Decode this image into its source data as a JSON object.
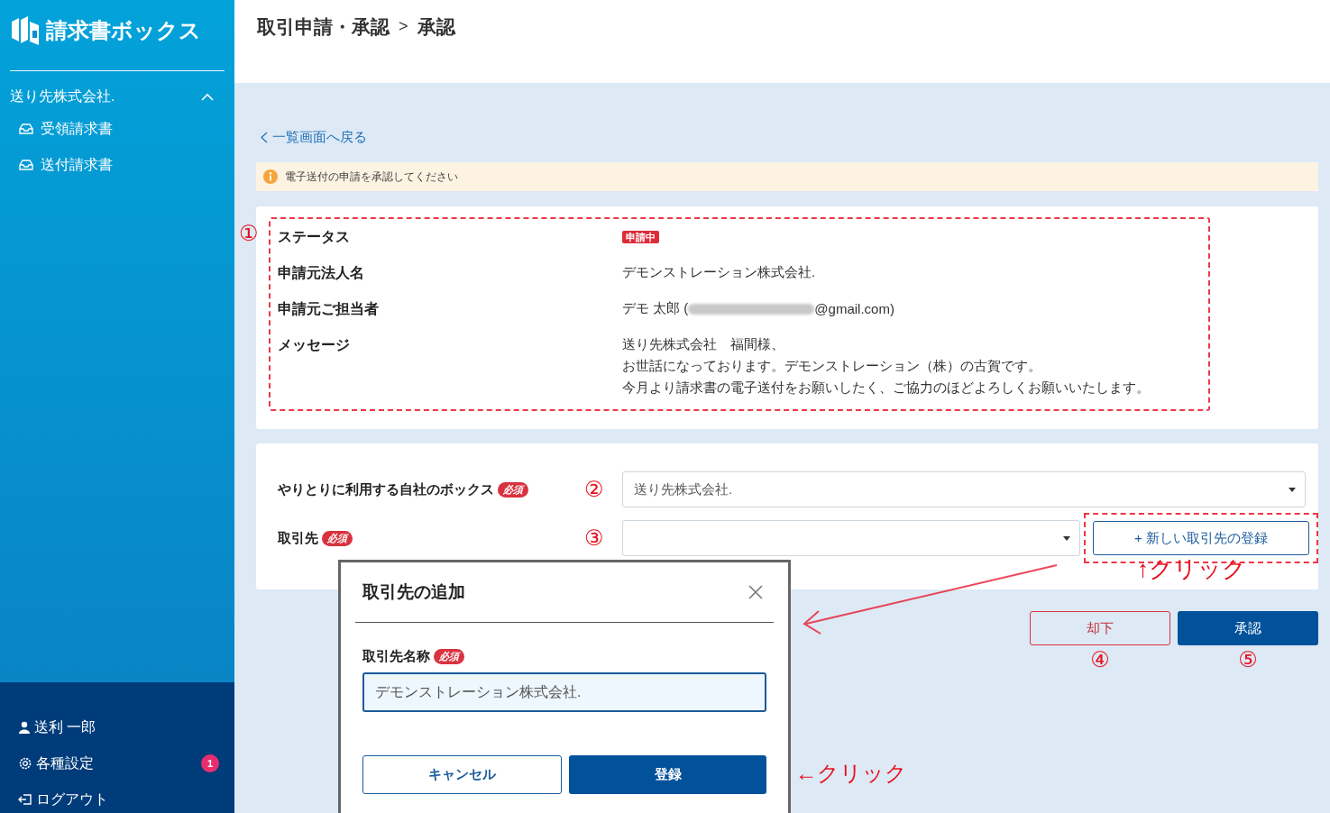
{
  "sidebar": {
    "logo": "請求書ボックス",
    "group": {
      "label": "送り先株式会社.",
      "expanded": true,
      "items": [
        {
          "label": "受領請求書"
        },
        {
          "label": "送付請求書"
        }
      ]
    },
    "footer": [
      {
        "kind": "user",
        "label": "送利 一郎"
      },
      {
        "kind": "settings",
        "label": "各種設定",
        "badge": "1"
      },
      {
        "kind": "logout",
        "label": "ログアウト"
      }
    ]
  },
  "header": {
    "breadcrumb": [
      "取引申請・承認",
      "承認"
    ],
    "separator": ">"
  },
  "back_link": "一覧画面へ戻る",
  "alert": "電子送付の申請を承認してください",
  "details": [
    {
      "label": "ステータス",
      "kind": "badge",
      "value": "申請中"
    },
    {
      "label": "申請元法人名",
      "kind": "text",
      "value": "デモンストレーション株式会社."
    },
    {
      "label": "申請元ご担当者",
      "kind": "contact",
      "value": "デモ 太郎 (",
      "value_end": "@gmail.com)"
    },
    {
      "label": "メッセージ",
      "kind": "lines",
      "lines": [
        "送り先株式会社　福間様、",
        "お世話になっております。デモンストレーション（株）の古賀です。",
        "今月より請求書の電子送付をお願いしたく、ご協力のほどよろしくお願いいたします。"
      ]
    }
  ],
  "form": [
    {
      "label": "やりとりに利用する自社のボックス",
      "required": "必須",
      "marker": "②",
      "value": "送り先株式会社."
    },
    {
      "label": "取引先",
      "required": "必須",
      "marker": "③",
      "button": "+ 新しい取引先の登録"
    }
  ],
  "actions": [
    {
      "kind": "reject",
      "label": "却下",
      "marker": "④"
    },
    {
      "kind": "approve",
      "label": "承認",
      "marker": "⑤"
    }
  ],
  "dialog": {
    "title": "取引先の追加",
    "field_label": "取引先名称",
    "required": "必須",
    "value": "デモンストレーション株式会社.",
    "buttons": [
      {
        "kind": "cancel",
        "label": "キャンセル"
      },
      {
        "kind": "submit",
        "label": "登録"
      }
    ]
  },
  "annotations": {
    "details_marker": "①",
    "click_up": "↑クリック",
    "click_left": "←クリック"
  }
}
